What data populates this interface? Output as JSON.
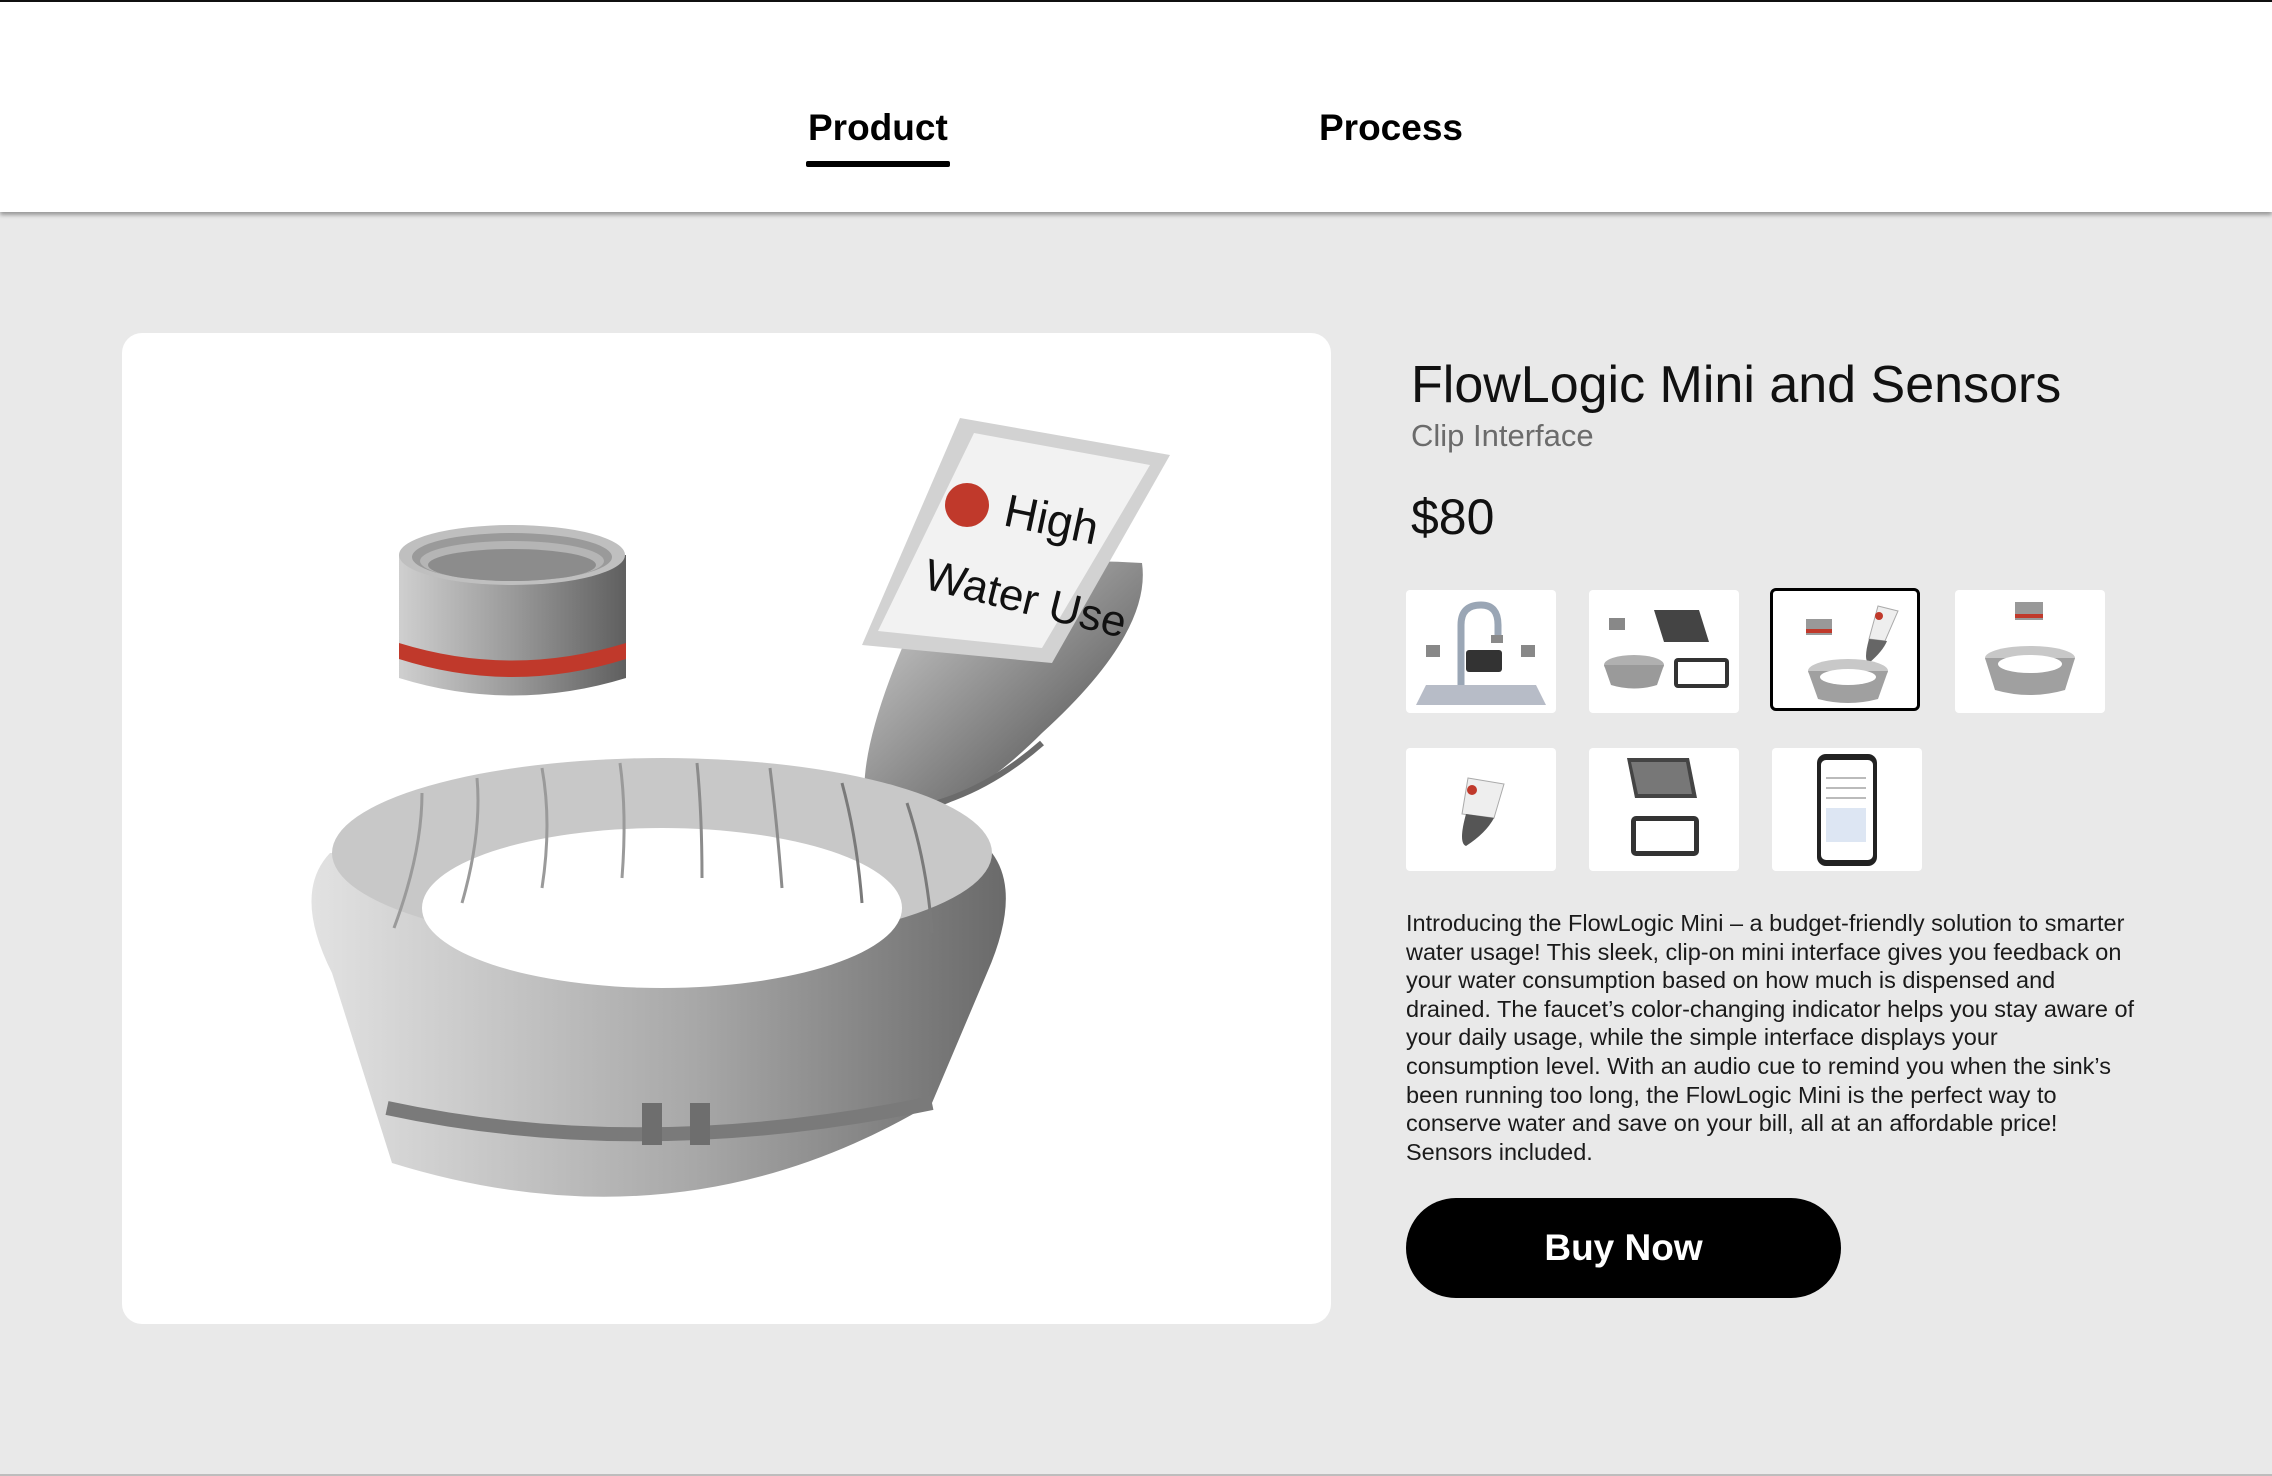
{
  "nav": {
    "tabs": [
      {
        "label": "Product",
        "active": true
      },
      {
        "label": "Process",
        "active": false
      }
    ]
  },
  "product": {
    "title": "FlowLogic Mini and Sensors",
    "subtitle": "Clip Interface",
    "price": "$80",
    "hero_sign_line1": "High",
    "hero_sign_line2": "Water Use",
    "description": "Introducing the FlowLogic Mini – a budget-friendly solution to smarter water usage! This sleek, clip-on mini interface gives you feedback on your water consumption based on how much is dispensed and drained. The faucet’s color-changing indicator helps you stay aware of your daily usage, while the simple interface displays your consumption level. With an audio cue to remind you when the sink’s been running too long, the FlowLogic Mini is the perfect way to conserve water and save on your bill, all at an affordable price! Sensors included.",
    "buy_label": "Buy Now"
  },
  "gallery": {
    "selected_index": 2,
    "thumbnails": [
      {
        "name": "faucet-with-sensors"
      },
      {
        "name": "sensors-and-tablets"
      },
      {
        "name": "sensors-and-clip"
      },
      {
        "name": "sensors-only"
      },
      {
        "name": "clip-interface"
      },
      {
        "name": "tablet-interfaces"
      },
      {
        "name": "phone-app"
      }
    ]
  },
  "colors": {
    "accent_red": "#c0392b",
    "button_bg": "#000000",
    "page_bg": "#e9e9e9"
  }
}
